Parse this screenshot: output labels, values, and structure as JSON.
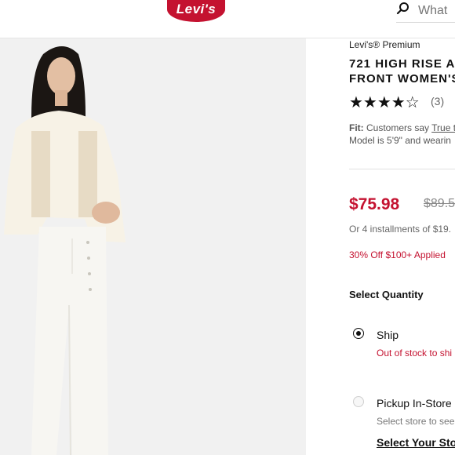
{
  "header": {
    "logo_text": "Levi's",
    "search_placeholder": "What"
  },
  "product": {
    "brand": "Levi's® Premium",
    "title_line1": "721 HIGH RISE A",
    "title_line2": "FRONT WOMEN'S",
    "rating": 4,
    "rating_stars": "★★★★☆",
    "review_count": "(3)",
    "fit_label": "Fit:",
    "fit_text": "Customers say",
    "fit_link": "True t",
    "model_text": "Model is 5'9\" and wearin",
    "price": "$75.98",
    "original_price": "$89.5",
    "installments": "Or 4 installments of $19.",
    "promo": "30% Off $100+ Applied"
  },
  "quantity": {
    "heading": "Select Quantity",
    "options": [
      {
        "label": "Ship",
        "status": "Out of stock to shi",
        "selected": true
      },
      {
        "label": "Pickup In-Store",
        "status": "Select store to see",
        "selected": false
      }
    ],
    "store_link": "Select Your Stor"
  },
  "colors": {
    "brand_red": "#c41230",
    "photo_bg": "#f1f1f1"
  }
}
